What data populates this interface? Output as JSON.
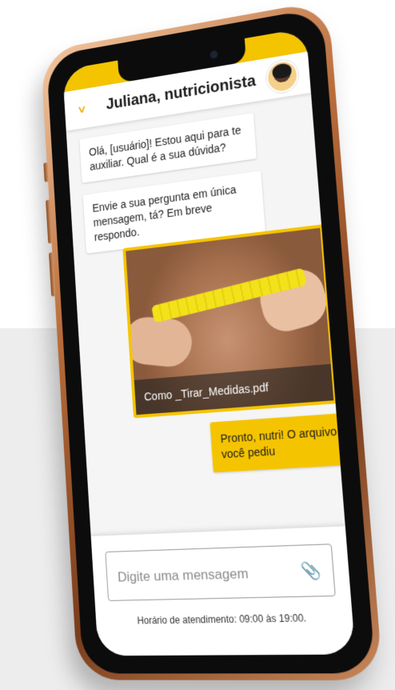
{
  "header": {
    "title": "Juliana, nutricionista",
    "collapse_icon": "chevron-down-icon",
    "avatar_alt": "avatar"
  },
  "messages": {
    "bot_1": "Olá, [usuário]! Estou aqui para te auxiliar. Qual é a sua dúvida?",
    "bot_2": "Envie a sua pergunta em única mensagem, tá? Em breve respondo.",
    "attachment_name": "Como _Tirar_Medidas.pdf",
    "user_1": "Pronto, nutri! O arquivo que você pediu"
  },
  "composer": {
    "placeholder": "Digite uma mensagem",
    "attach_icon": "paperclip-icon",
    "hours": "Horário de atendimento: 09:00 às 19:00."
  },
  "colors": {
    "accent": "#f5c400",
    "chevron": "#f2a900",
    "page_bg_band": "#ededee"
  }
}
